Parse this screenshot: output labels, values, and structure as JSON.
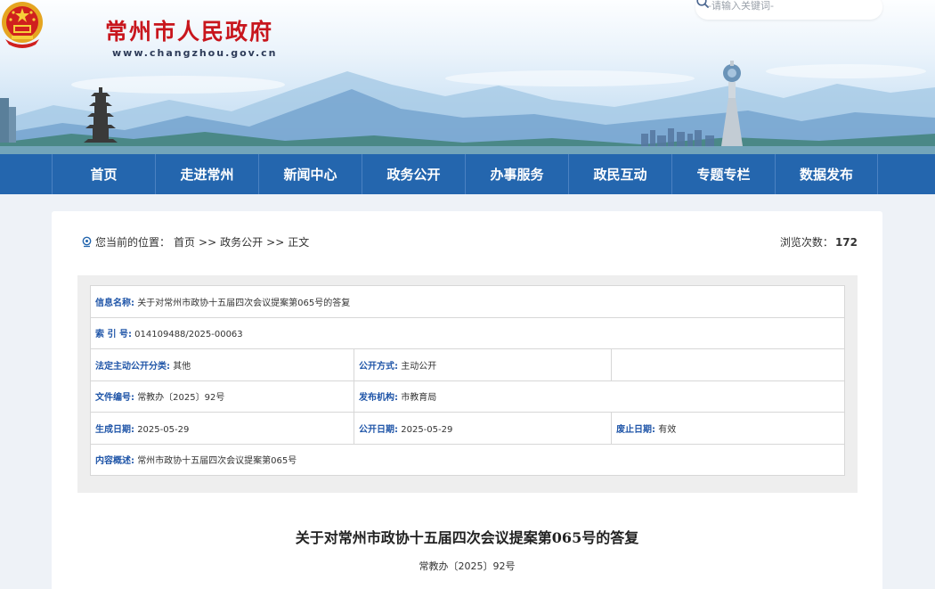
{
  "site": {
    "title": "常州市人民政府",
    "url": "www.changzhou.gov.cn"
  },
  "search": {
    "placeholder": "-请输入关键词-",
    "icon": "search-icon"
  },
  "nav": {
    "items": [
      {
        "label": "首页"
      },
      {
        "label": "走进常州"
      },
      {
        "label": "新闻中心"
      },
      {
        "label": "政务公开"
      },
      {
        "label": "办事服务"
      },
      {
        "label": "政民互动"
      },
      {
        "label": "专题专栏"
      },
      {
        "label": "数据发布"
      }
    ]
  },
  "breadcrumb": {
    "prefix": "您当前的位置：",
    "items": [
      "首页",
      "政务公开",
      "正文"
    ],
    "sep": ">>"
  },
  "views": {
    "label": "浏览次数：",
    "count": "172"
  },
  "info": {
    "name_label": "信息名称:",
    "name_value": "关于对常州市政协十五届四次会议提案第065号的答复",
    "index_label": "索 引 号:",
    "index_value": "014109488/2025-00063",
    "category_label": "法定主动公开分类:",
    "category_value": "其他",
    "method_label": "公开方式:",
    "method_value": "主动公开",
    "docno_label": "文件编号:",
    "docno_value": "常教办〔2025〕92号",
    "org_label": "发布机构:",
    "org_value": "市教育局",
    "date_label": "生成日期:",
    "date_value": "2025-05-29",
    "pubdate_label": "公开日期:",
    "pubdate_value": "2025-05-29",
    "expire_label": "废止日期:",
    "expire_value": "有效",
    "summary_label": "内容概述:",
    "summary_value": "常州市政协十五届四次会议提案第065号"
  },
  "document": {
    "title": "关于对常州市政协十五届四次会议提案第065号的答复",
    "number": "常教办〔2025〕92号"
  },
  "colors": {
    "nav_bg": "#2466ae",
    "title_red": "#c8161d",
    "label_blue": "#1f55a8"
  }
}
